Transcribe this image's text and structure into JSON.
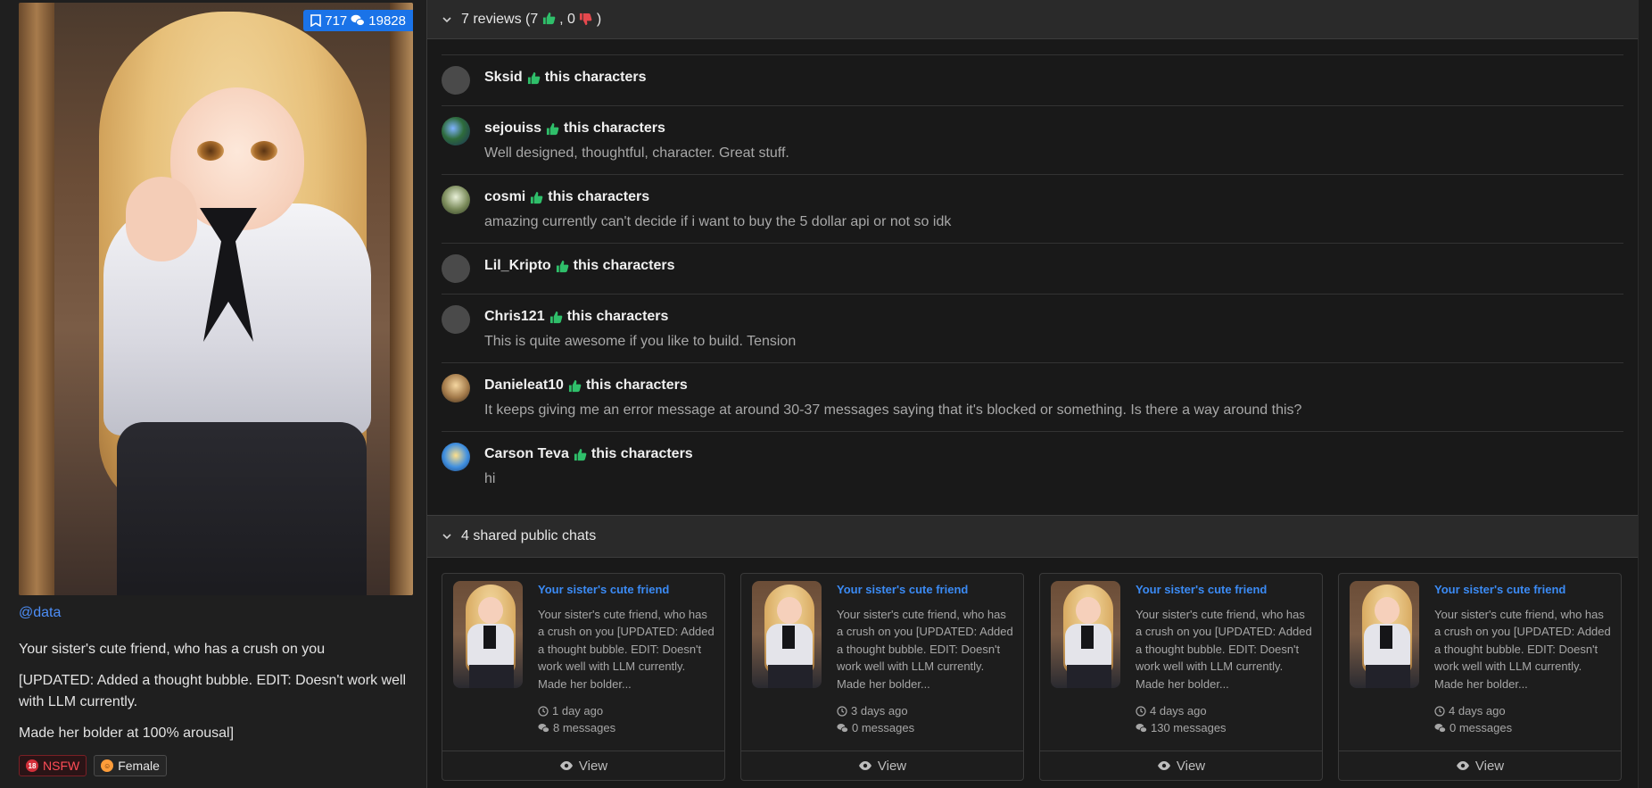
{
  "character": {
    "stats": {
      "bookmarks": "717",
      "chats": "19828"
    },
    "creator": "@data",
    "description": [
      "Your sister's cute friend, who has a crush on you",
      "[UPDATED: Added a thought bubble. EDIT: Doesn't work well with LLM currently.",
      "Made her bolder at 100% arousal]"
    ],
    "tags": [
      {
        "label": "NSFW",
        "icon": "18-plus-icon",
        "color": "#ff4d57"
      },
      {
        "label": "Female",
        "icon": "female-face-icon",
        "color": "#ff9d3a"
      }
    ]
  },
  "reviews": {
    "header": {
      "prefix": "7 reviews (7",
      "middle": ", 0",
      "suffix": ")"
    },
    "verb": "this characters",
    "items": [
      {
        "name": "Sksid",
        "text": "",
        "avatar": "none"
      },
      {
        "name": "sejouiss",
        "text": "Well designed, thoughtful, character. Great stuff.",
        "avatar": "img1"
      },
      {
        "name": "cosmi",
        "text": "amazing currently can't decide if i want to buy the 5 dollar api or not so idk",
        "avatar": "img2"
      },
      {
        "name": "Lil_Kripto",
        "text": "",
        "avatar": "none"
      },
      {
        "name": "Chris121",
        "text": "This is quite awesome if you like to build. Tension",
        "avatar": "none"
      },
      {
        "name": "Danieleat10",
        "text": "It keeps giving me an error message at around 30-37 messages saying that it's blocked or something. Is there a way around this?",
        "avatar": "img3"
      },
      {
        "name": "Carson Teva",
        "text": "hi",
        "avatar": "img4"
      }
    ]
  },
  "shared_chats": {
    "header": "4 shared public chats",
    "view_label": "View",
    "items": [
      {
        "title": "Your sister's cute friend",
        "snippet": "Your sister's cute friend, who has a crush on you [UPDATED: Added a thought bubble. EDIT: Doesn't work well with LLM currently. Made her bolder...",
        "time": "1 day ago",
        "messages": "8 messages"
      },
      {
        "title": "Your sister's cute friend",
        "snippet": "Your sister's cute friend, who has a crush on you [UPDATED: Added a thought bubble. EDIT: Doesn't work well with LLM currently. Made her bolder...",
        "time": "3 days ago",
        "messages": "0 messages"
      },
      {
        "title": "Your sister's cute friend",
        "snippet": "Your sister's cute friend, who has a crush on you [UPDATED: Added a thought bubble. EDIT: Doesn't work well with LLM currently. Made her bolder...",
        "time": "4 days ago",
        "messages": "130 messages"
      },
      {
        "title": "Your sister's cute friend",
        "snippet": "Your sister's cute friend, who has a crush on you [UPDATED: Added a thought bubble. EDIT: Doesn't work well with LLM currently. Made her bolder...",
        "time": "4 days ago",
        "messages": "0 messages"
      }
    ]
  },
  "colors": {
    "accent": "#1a73e8",
    "link": "#3b8bf5",
    "thumb_up": "#2fbf6a",
    "thumb_down": "#e5484d",
    "nsfw": "#ff4d57"
  }
}
